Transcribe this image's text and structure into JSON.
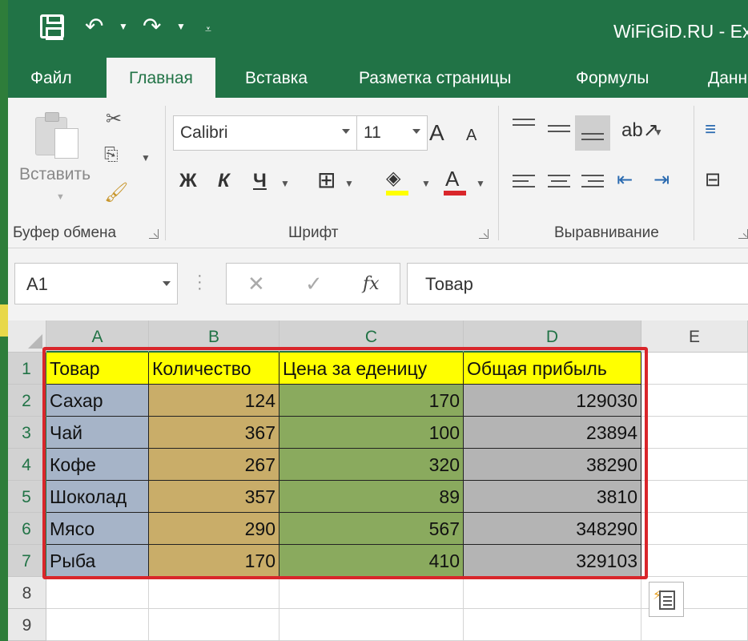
{
  "window": {
    "title": "WiFiGiD.RU - Ex"
  },
  "quick_access": {
    "save_icon": "save-icon",
    "undo_icon": "undo-icon",
    "redo_icon": "redo-icon"
  },
  "tabs": [
    {
      "label": "Файл"
    },
    {
      "label": "Главная"
    },
    {
      "label": "Вставка"
    },
    {
      "label": "Разметка страницы"
    },
    {
      "label": "Формулы"
    },
    {
      "label": "Данн"
    }
  ],
  "ribbon": {
    "clipboard": {
      "paste_label": "Вставить",
      "group_label": "Буфер обмена"
    },
    "font": {
      "font_name": "Calibri",
      "font_size": "11",
      "increase": "A",
      "decrease": "A",
      "bold": "Ж",
      "italic": "К",
      "underline": "Ч",
      "color_letter": "A",
      "group_label": "Шрифт"
    },
    "alignment": {
      "group_label": "Выравнивание"
    }
  },
  "formula_bar": {
    "name_box": "A1",
    "cancel": "✕",
    "enter": "✓",
    "fx": "fx",
    "content": "Товар"
  },
  "sheet": {
    "columns": [
      "A",
      "B",
      "C",
      "D",
      "E"
    ],
    "rows": [
      "1",
      "2",
      "3",
      "4",
      "5",
      "6",
      "7",
      "8",
      "9"
    ],
    "table": {
      "headers": [
        "Товар",
        "Количество",
        "Цена за еденицу",
        "Общая прибыль"
      ],
      "rows": [
        [
          "Сахар",
          "124",
          "170",
          "129030"
        ],
        [
          "Чай",
          "367",
          "100",
          "23894"
        ],
        [
          "Кофе",
          "267",
          "320",
          "38290"
        ],
        [
          "Шоколад",
          "357",
          "89",
          "3810"
        ],
        [
          "Мясо",
          "290",
          "567",
          "348290"
        ],
        [
          "Рыба",
          "170",
          "410",
          "329103"
        ]
      ]
    },
    "colors": {
      "header": "#ffff00",
      "col_a": "#a6b4c8",
      "col_b": "#c9ad69",
      "col_c": "#8aaa5e",
      "col_d": "#b4b4b4",
      "outline": "#d9262b",
      "accent": "#217346"
    }
  }
}
